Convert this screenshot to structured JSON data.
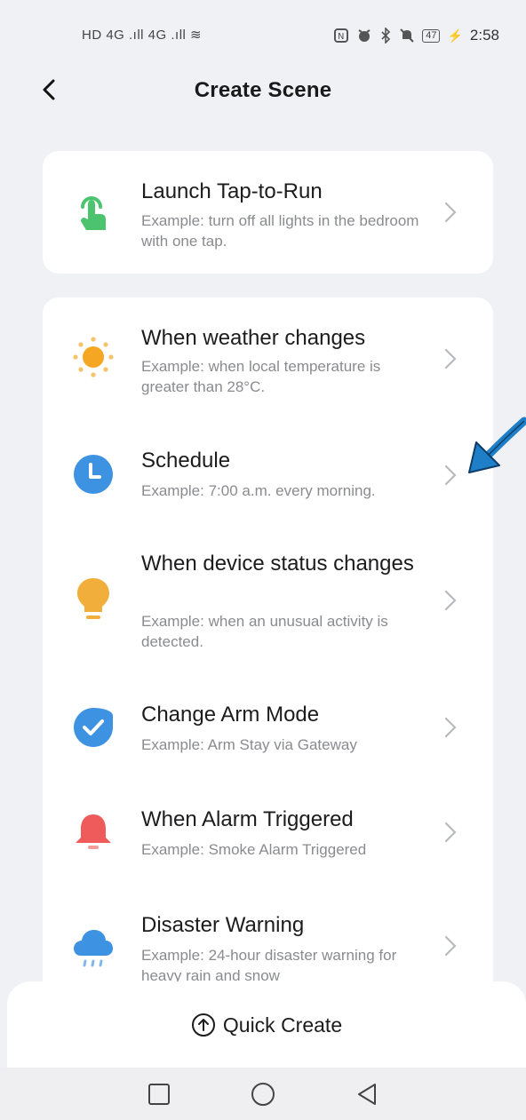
{
  "status_bar": {
    "left": "HD 4G .ıll 4G .ıll ≋",
    "battery": "47",
    "time": "2:58"
  },
  "header": {
    "title": "Create Scene"
  },
  "launch_card": {
    "title": "Launch Tap-to-Run",
    "subtitle": "Example: turn off all lights in the bedroom with one tap.",
    "icon": "tap-hand-icon",
    "icon_color": "#4cc46f"
  },
  "conditions": [
    {
      "title": "When weather changes",
      "subtitle": "Example: when local temperature is greater than 28°C.",
      "icon": "sun-icon",
      "icon_color": "#f5a623"
    },
    {
      "title": "Schedule",
      "subtitle": "Example: 7:00 a.m. every morning.",
      "icon": "clock-icon",
      "icon_color": "#3e92e2"
    },
    {
      "title": "When device status changes",
      "subtitle": "Example: when an unusual activity is detected.",
      "icon": "lightbulb-icon",
      "icon_color": "#f2ae3a"
    },
    {
      "title": "Change Arm Mode",
      "subtitle": "Example: Arm Stay via Gateway",
      "icon": "shield-check-icon",
      "icon_color": "#3e92e2"
    },
    {
      "title": "When Alarm Triggered",
      "subtitle": "Example: Smoke Alarm Triggered",
      "icon": "alarm-bell-icon",
      "icon_color": "#ef5a5a"
    },
    {
      "title": "Disaster Warning",
      "subtitle": "Example: 24-hour disaster warning for heavy rain and snow",
      "icon": "rain-cloud-icon",
      "icon_color": "#3e92e2"
    }
  ],
  "bottom": {
    "quick_create": "Quick Create"
  },
  "colors": {
    "background": "#f0f1f5",
    "card": "#ffffff",
    "annotation_arrow": "#1e7fc8"
  }
}
